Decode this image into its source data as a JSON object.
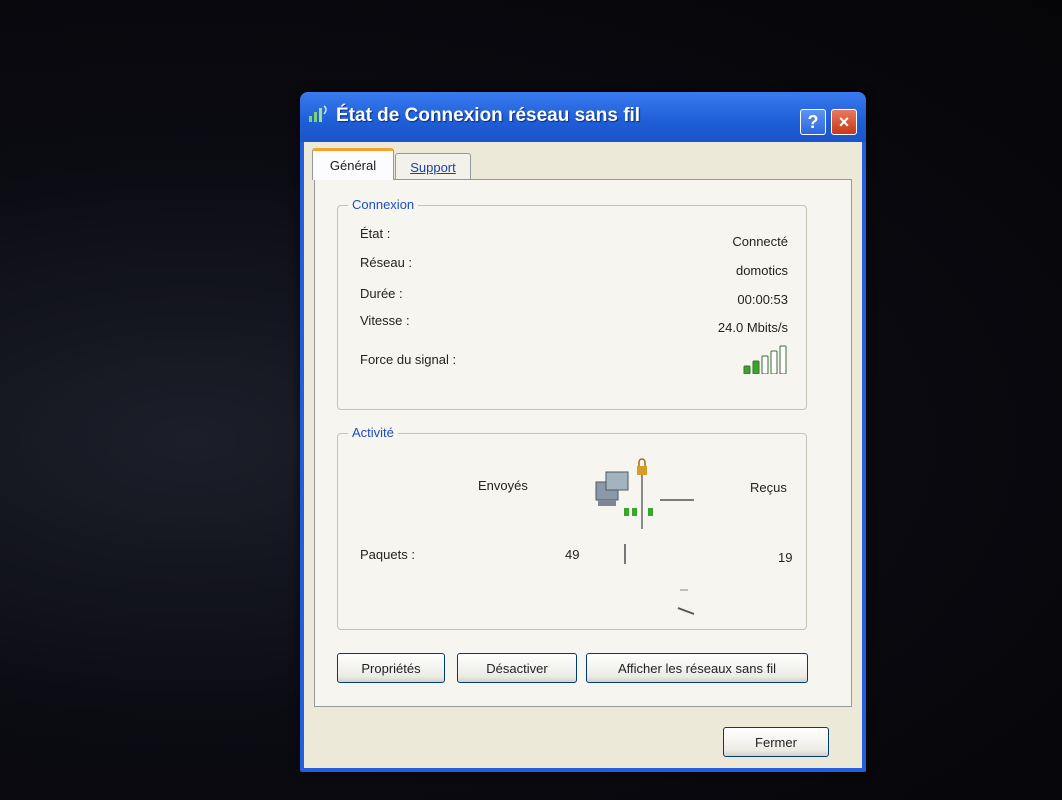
{
  "window": {
    "title": "État de Connexion réseau sans fil",
    "help_label": "?",
    "close_label": "×"
  },
  "tabs": [
    {
      "label": "Général",
      "active": true
    },
    {
      "label": "Support",
      "active": false
    }
  ],
  "connexion": {
    "legend": "Connexion",
    "rows": [
      {
        "label": "État :",
        "value": "Connecté"
      },
      {
        "label": "Réseau :",
        "value": "domotics"
      },
      {
        "label": "Durée :",
        "value": "00:00:53"
      },
      {
        "label": "Vitesse :",
        "value": "24.0 Mbits/s"
      }
    ],
    "signal_label": "Force du signal :",
    "signal_bars_lit": 2,
    "signal_bars_total": 5
  },
  "activite": {
    "legend": "Activité",
    "sent_label": "Envoyés",
    "received_label": "Reçus",
    "packets_label": "Paquets :",
    "packets_sent": "49",
    "packets_received": "19"
  },
  "buttons": {
    "properties": "Propriétés",
    "disable": "Désactiver",
    "view_networks": "Afficher les réseaux sans fil",
    "close": "Fermer"
  },
  "colors": {
    "titlebar": "#245edc",
    "group_legend": "#1f4fbe",
    "signal_lit": "#3aa52d",
    "active_tab_accent": "#f3a32d"
  }
}
